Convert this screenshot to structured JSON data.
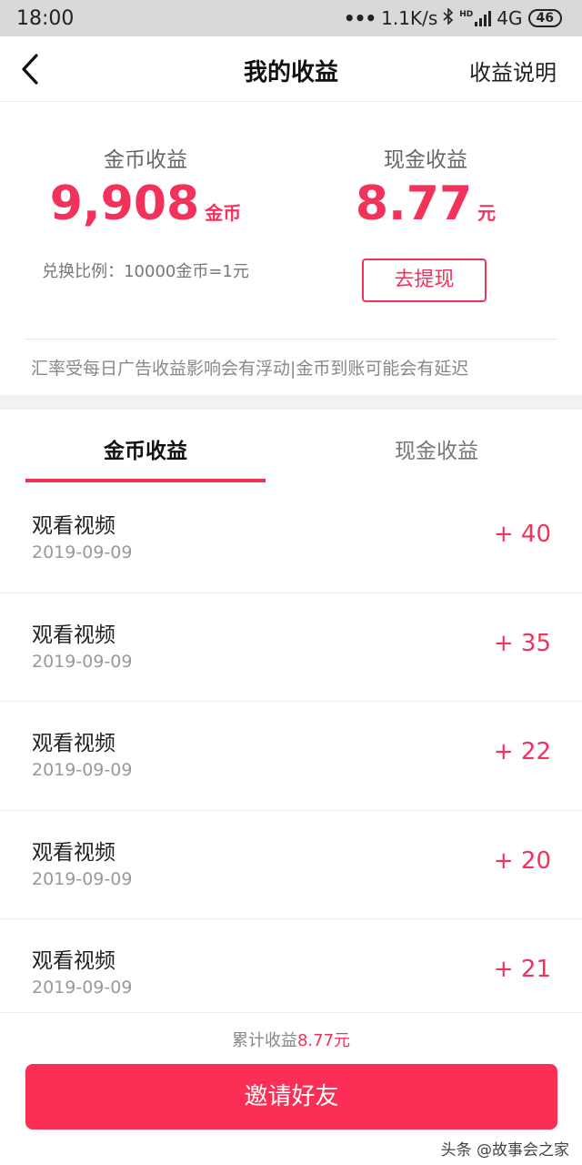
{
  "status_bar": {
    "time": "18:00",
    "network_speed": "1.1K/s",
    "signal_badge": "HD",
    "network_type": "4G",
    "battery": "46"
  },
  "navbar": {
    "back_icon": "chevron-left-icon",
    "title": "我的收益",
    "help_label": "收益说明"
  },
  "summary": {
    "coins": {
      "label": "金币收益",
      "amount": "9,908",
      "unit": "金币"
    },
    "cash": {
      "label": "现金收益",
      "amount": "8.77",
      "unit": "元"
    },
    "ratio_text": "兑换比例：10000金币=1元",
    "withdraw_label": "去提现",
    "notice": "汇率受每日广告收益影响会有浮动|金币到账可能会有延迟"
  },
  "tabs": [
    {
      "label": "金币收益",
      "active": true
    },
    {
      "label": "现金收益",
      "active": false
    }
  ],
  "records": [
    {
      "title": "观看视频",
      "date": "2019-09-09",
      "amount": "+ 40"
    },
    {
      "title": "观看视频",
      "date": "2019-09-09",
      "amount": "+ 35"
    },
    {
      "title": "观看视频",
      "date": "2019-09-09",
      "amount": "+ 22"
    },
    {
      "title": "观看视频",
      "date": "2019-09-09",
      "amount": "+ 20"
    },
    {
      "title": "观看视频",
      "date": "2019-09-09",
      "amount": "+ 21"
    }
  ],
  "footer": {
    "total_label": "累计收益",
    "total_value": "8.77元",
    "invite_label": "邀请好友",
    "watermark": "头条 @故事会之家"
  },
  "colors": {
    "accent": "#f2325a",
    "button": "#fb2f56"
  }
}
